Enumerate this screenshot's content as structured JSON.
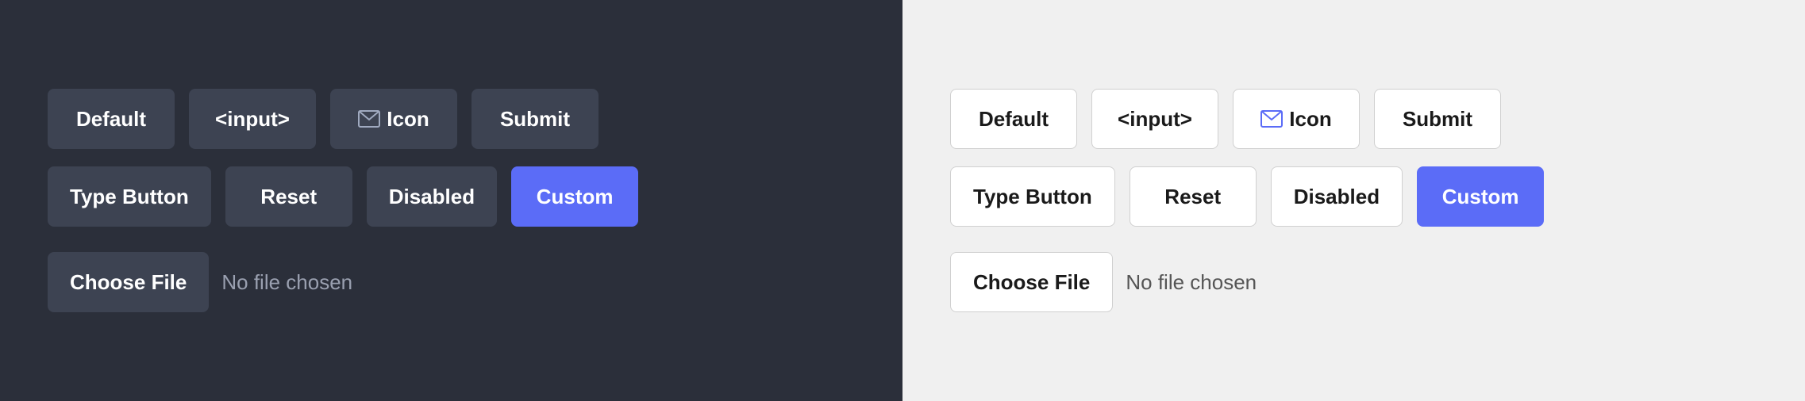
{
  "dark_panel": {
    "row1": {
      "btn1": "Default",
      "btn2": "<input>",
      "btn3_icon": "envelope",
      "btn3_label": "Icon",
      "btn4": "Submit"
    },
    "row2": {
      "btn1": "Type Button",
      "btn2": "Reset",
      "btn3": "Disabled",
      "btn4": "Custom"
    },
    "file": {
      "button_label": "Choose File",
      "no_file_text": "No file chosen"
    }
  },
  "light_panel": {
    "row1": {
      "btn1": "Default",
      "btn2": "<input>",
      "btn3_icon": "envelope",
      "btn3_label": "Icon",
      "btn4": "Submit"
    },
    "row2": {
      "btn1": "Type Button",
      "btn2": "Reset",
      "btn3": "Disabled",
      "btn4": "Custom"
    },
    "file": {
      "button_label": "Choose File",
      "no_file_text": "No file chosen"
    }
  },
  "colors": {
    "custom_btn": "#5b6cf7",
    "dark_bg": "#2b2f3a",
    "dark_btn_bg": "#3d4352",
    "light_bg": "#f0f0f0",
    "light_btn_bg": "#ffffff",
    "light_btn_border": "#d0d0d0"
  }
}
